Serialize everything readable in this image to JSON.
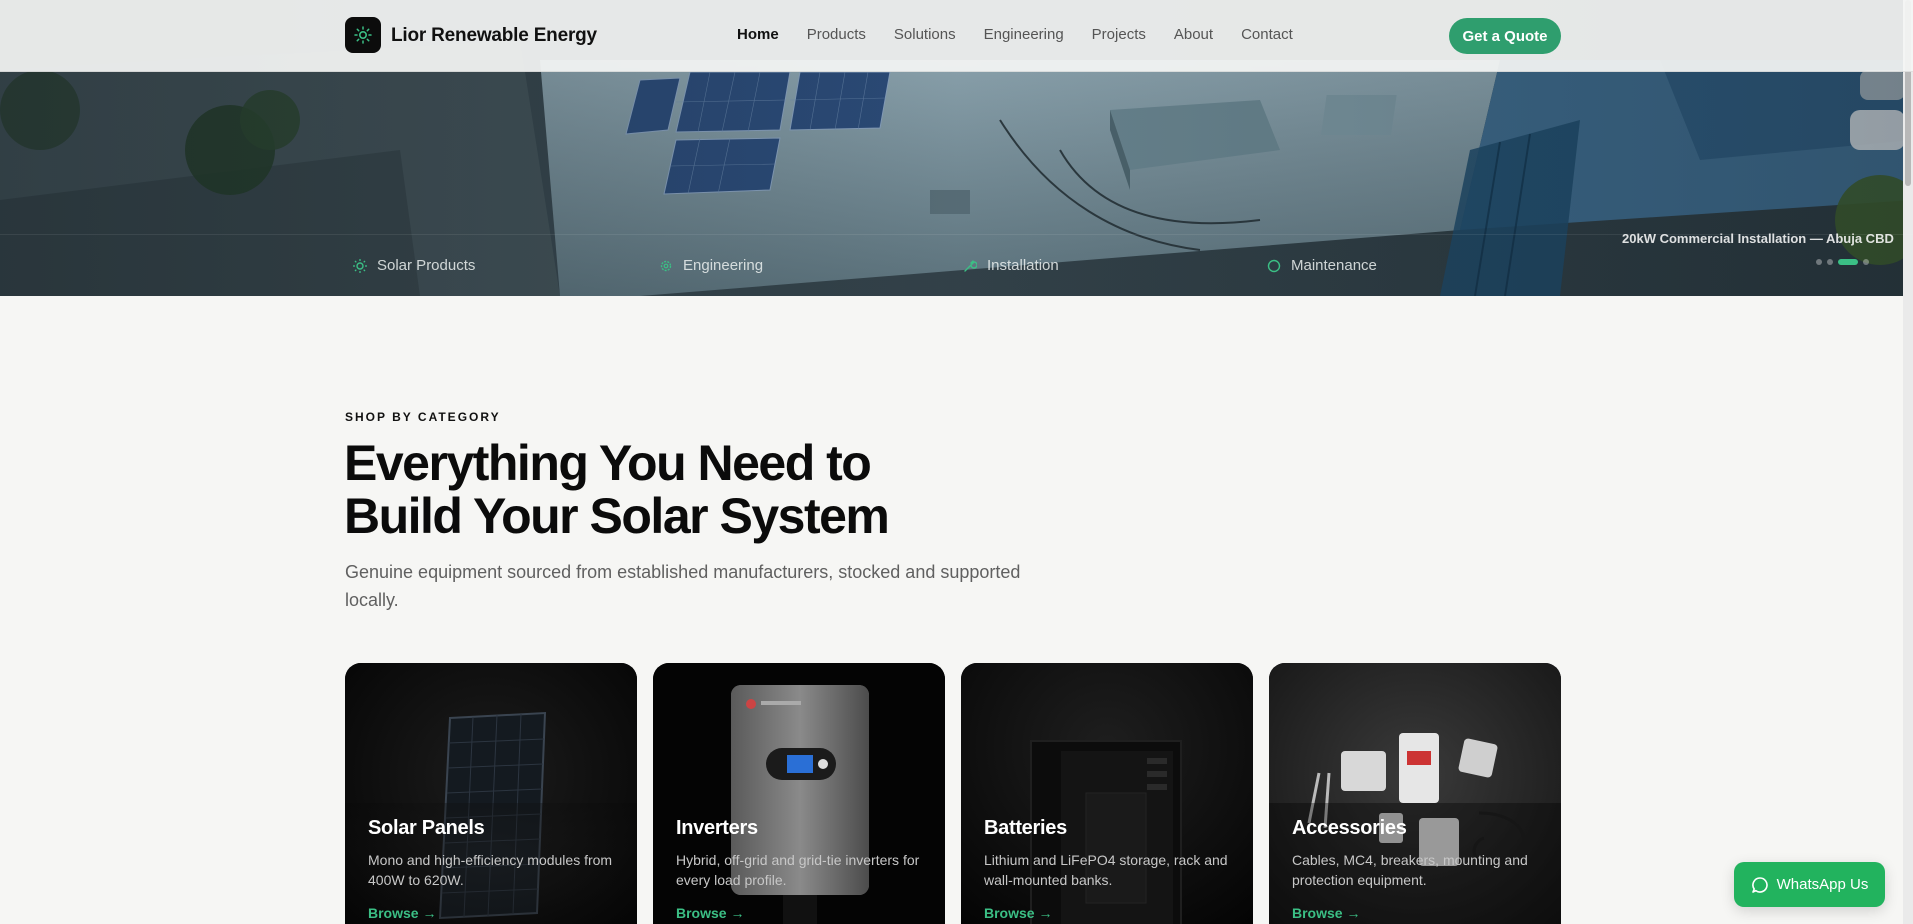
{
  "nav": {
    "brand": "Lior Renewable Energy",
    "links": [
      {
        "label": "Home",
        "active": true
      },
      {
        "label": "Products"
      },
      {
        "label": "Solutions"
      },
      {
        "label": "Engineering"
      },
      {
        "label": "Projects"
      },
      {
        "label": "About"
      },
      {
        "label": "Contact"
      }
    ],
    "cta": "Get a Quote"
  },
  "hero": {
    "features": [
      "Solar Products",
      "Engineering",
      "Installation",
      "Maintenance"
    ],
    "caption": "20kW Commercial Installation — Abuja CBD",
    "slide_count": 4,
    "active_slide": 3
  },
  "section": {
    "eyebrow": "SHOP BY CATEGORY",
    "heading_line1": "Everything You Need to",
    "heading_line2": "Build Your Solar System",
    "subtitle": "Genuine equipment sourced from established manufacturers, stocked and supported locally."
  },
  "cards": [
    {
      "title": "Solar Panels",
      "desc": "Mono and high-efficiency modules from 400W to 620W.",
      "link": "Browse →"
    },
    {
      "title": "Inverters",
      "desc": "Hybrid, off-grid and grid-tie inverters for every load profile.",
      "link": "Browse →"
    },
    {
      "title": "Batteries",
      "desc": "Lithium and LiFePO4 storage, rack and wall-mounted banks.",
      "link": "Browse →"
    },
    {
      "title": "Accessories",
      "desc": "Cables, MC4, breakers, mounting and protection equipment.",
      "link": "Browse →"
    }
  ],
  "whatsapp": "WhatsApp Us",
  "colors": {
    "accent": "#2f9e6e",
    "accent_light": "#3bbf85",
    "whatsapp": "#22b35e",
    "dark": "#0c0c0c"
  }
}
